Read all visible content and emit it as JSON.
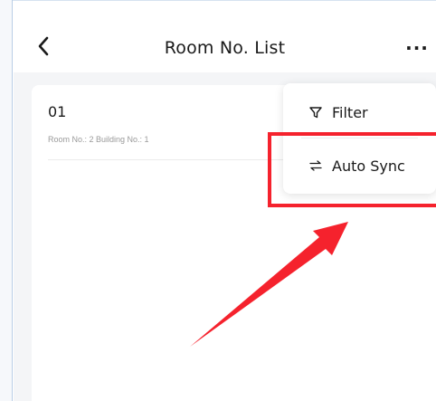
{
  "header": {
    "title": "Room No. List",
    "more_label": "···"
  },
  "room": {
    "number": "01",
    "details": "Room No.: 2 Building No.: 1"
  },
  "menu": {
    "items": [
      {
        "label": "Filter",
        "icon": "filter-icon"
      },
      {
        "label": "Auto Sync",
        "icon": "sync-icon"
      }
    ]
  },
  "annotation": {
    "highlight_color": "#f5222d",
    "arrow_color": "#f5222d",
    "target": "Auto Sync"
  }
}
